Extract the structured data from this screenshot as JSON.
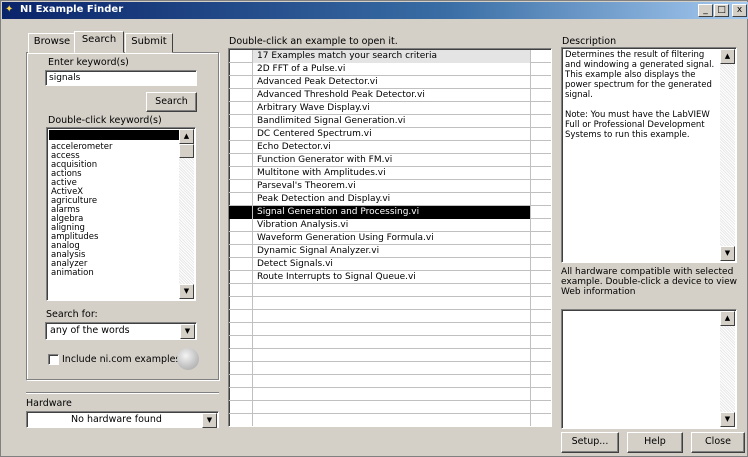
{
  "window": {
    "title": "NI Example Finder",
    "title_icon": "ni-icon",
    "controls": {
      "minimize": "_",
      "maximize": "□",
      "close": "x"
    }
  },
  "tabs": [
    {
      "label": "Browse",
      "active": false
    },
    {
      "label": "Search",
      "active": true
    },
    {
      "label": "Submit",
      "active": false
    }
  ],
  "search": {
    "keyword_label": "Enter keyword(s)",
    "keyword_value": "signals",
    "search_button": "Search",
    "double_click_label": "Double-click keyword(s)",
    "keywords": [
      "accelerometer",
      "access",
      "acquisition",
      "actions",
      "active",
      "ActiveX",
      "agriculture",
      "alarms",
      "algebra",
      "aligning",
      "amplitudes",
      "analog",
      "analysis",
      "analyzer",
      "animation"
    ],
    "search_for_label": "Search for:",
    "search_for_value": "any of the words",
    "include_ni_label": "Include ni.com examples",
    "include_ni_checked": false,
    "globe_icon": "globe-icon"
  },
  "hardware": {
    "label": "Hardware",
    "value": "No hardware found"
  },
  "examples": {
    "instruction": "Double-click an example to open it.",
    "header": "17 Examples match your search criteria",
    "items": [
      "2D FFT of a Pulse.vi",
      "Advanced Peak Detector.vi",
      "Advanced Threshold Peak Detector.vi",
      "Arbitrary Wave Display.vi",
      "Bandlimited Signal Generation.vi",
      "DC Centered Spectrum.vi",
      "Echo Detector.vi",
      "Function Generator with FM.vi",
      "Multitone with Amplitudes.vi",
      "Parseval's Theorem.vi",
      "Peak Detection and Display.vi",
      "Signal Generation and Processing.vi",
      "Vibration Analysis.vi",
      "Waveform Generation Using Formula.vi",
      "Dynamic Signal Analyzer.vi",
      "Detect Signals.vi",
      "Route Interrupts to Signal Queue.vi"
    ],
    "selected_index": 11
  },
  "description": {
    "label": "Description",
    "text": "Determines the result of filtering and windowing a generated signal. This example also displays the power spectrum for the generated signal.\n\nNote: You must have the LabVIEW Full or Professional Development Systems to run this example."
  },
  "hardware_info": {
    "text": "All hardware compatible with selected example.  Double-click a device to view Web information"
  },
  "buttons": {
    "setup": "Setup...",
    "help": "Help",
    "close": "Close"
  }
}
